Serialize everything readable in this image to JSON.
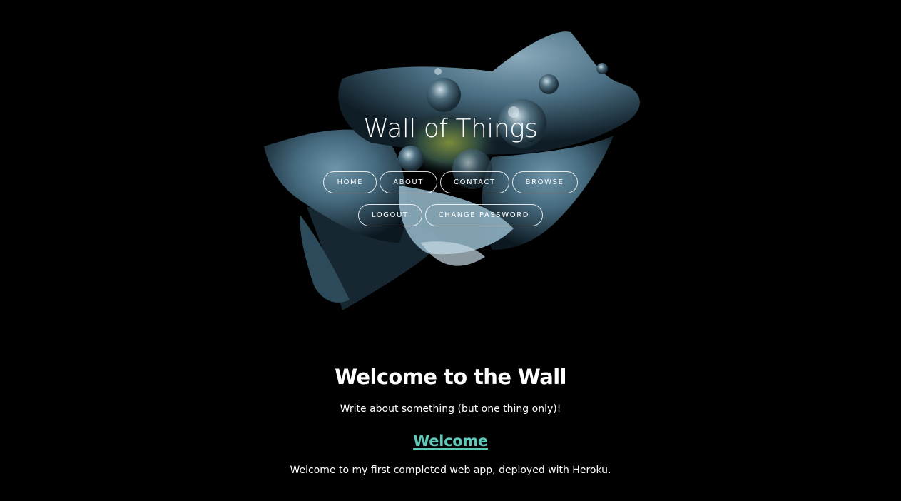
{
  "site": {
    "title": "Wall of Things"
  },
  "nav": {
    "row1": [
      "HOME",
      "ABOUT",
      "CONTACT",
      "BROWSE"
    ],
    "row2": [
      "LOGOUT",
      "CHANGE PASSWORD"
    ]
  },
  "main": {
    "heading": "Welcome to the Wall",
    "tagline": "Write about something (but one thing only)!",
    "post": {
      "title": "Welcome",
      "body": "Welcome to my first completed web app, deployed with Heroku."
    }
  },
  "colors": {
    "background": "#000000",
    "text": "#ffffff",
    "link": "#5fc8b9",
    "petal": "#3d6276"
  },
  "icons": {
    "hero": "flower-with-water-drops-image"
  }
}
